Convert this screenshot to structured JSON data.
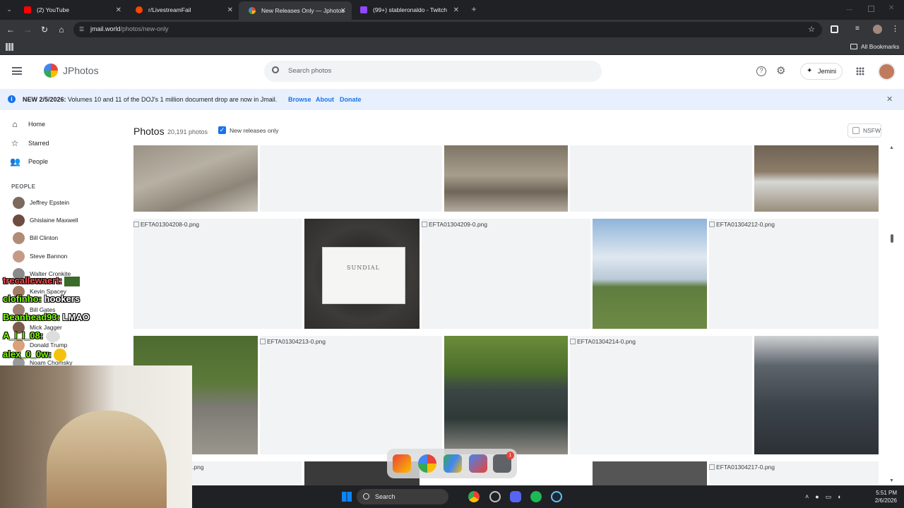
{
  "browser": {
    "tabs": [
      {
        "title": "(2) YouTube",
        "color": "#ff0000"
      },
      {
        "title": "r/LivestreamFail",
        "color": "#ff4500"
      },
      {
        "title": "New Releases Only — Jphotos",
        "color": "#4285f4"
      },
      {
        "title": "(99+) stableronaldo - Twitch",
        "color": "#9146ff"
      }
    ],
    "url_host": "jmail.world",
    "url_path": "/photos/new-only",
    "bookmarks_label": "All Bookmarks"
  },
  "app": {
    "brand": "JPhotos",
    "search_placeholder": "Search photos",
    "assistant_label": "Jemini"
  },
  "banner": {
    "prefix": "NEW 2/5/2026:",
    "text": "Volumes 10 and 11 of the DOJ's 1 million document drop are now in Jmail.",
    "links": [
      "Browse",
      "About",
      "Donate"
    ]
  },
  "sidebar": {
    "nav": [
      {
        "label": "Home",
        "icon": "home-icon"
      },
      {
        "label": "Starred",
        "icon": "star-icon"
      },
      {
        "label": "People",
        "icon": "people-icon"
      }
    ],
    "people_heading": "PEOPLE",
    "people": [
      "Jeffrey Epstein",
      "Ghislaine Maxwell",
      "Bill Clinton",
      "Steve Bannon",
      "Walter Cronkite",
      "Kevin Spacey",
      "Bill Gates",
      "Mick Jagger",
      "Donald Trump",
      "Noam Chomsky"
    ]
  },
  "main": {
    "title": "Photos",
    "count": "20,191 photos",
    "filter_label": "New releases only",
    "filter_checked": true,
    "nsfw_label": "NSFW",
    "broken_files": [
      "EFTA01304208-0.png",
      "EFTA01304209-0.png",
      "EFTA01304212-0.png",
      "EFTA01304213-0.png",
      "EFTA01304214-0.png",
      ".png",
      "EFTA01304217-0.png"
    ],
    "sign_text": "SUNDIAL"
  },
  "chat": [
    {
      "user": "trecallewaert:",
      "msg": ""
    },
    {
      "user": "clofinho:",
      "msg": "hookers"
    },
    {
      "user": "Beanhead93:",
      "msg": "LMAO"
    },
    {
      "user": "A_l_l_08:",
      "msg": ""
    },
    {
      "user": "alex_0_0w:",
      "msg": ""
    }
  ],
  "taskbar": {
    "search_label": "Search",
    "time": "5:51 PM",
    "date": "2/6/2026",
    "dock_badge": "1"
  }
}
